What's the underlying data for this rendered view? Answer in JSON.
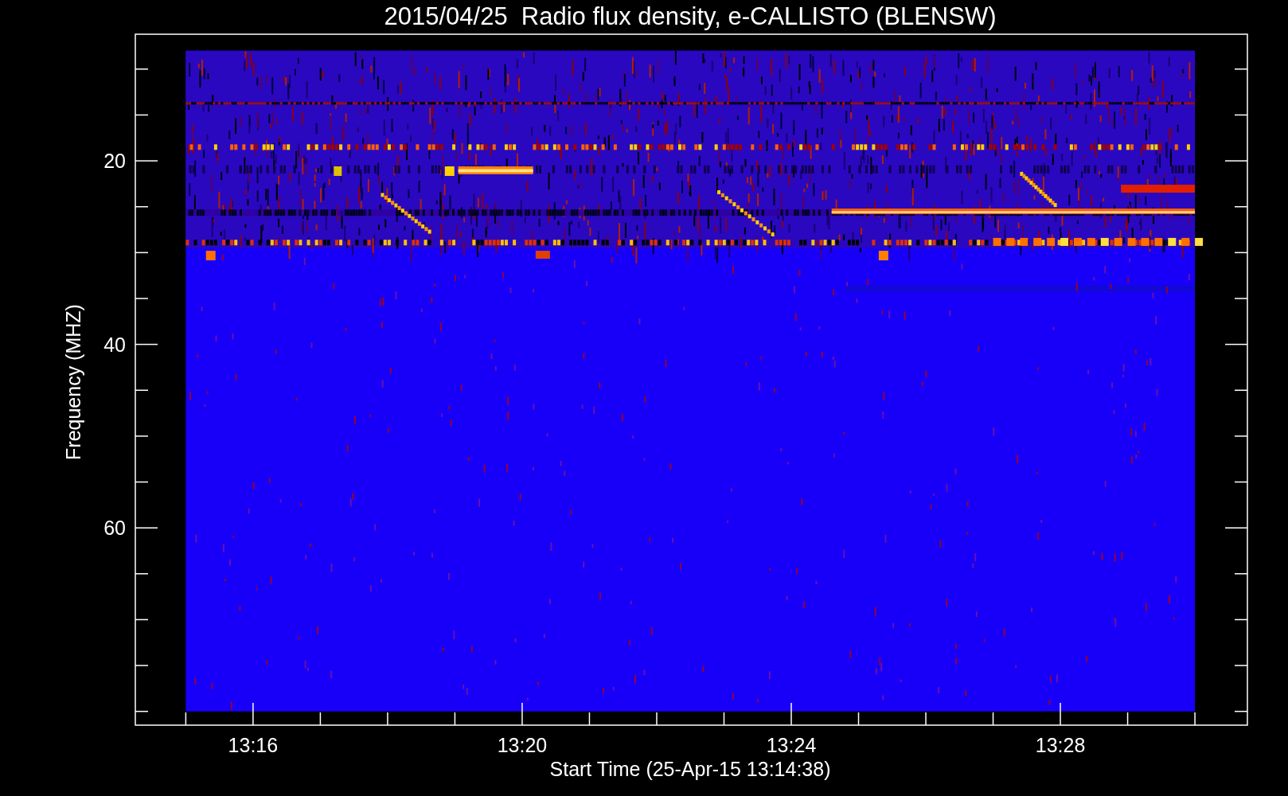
{
  "plot": {
    "title": "2015/04/25  Radio flux density, e-CALLISTO (BLENSW)",
    "xlabel": "Start Time (25-Apr-15 13:14:38)",
    "ylabel": "Frequency (MHZ)",
    "xticks": [
      "13:16",
      "13:20",
      "13:24",
      "13:28"
    ],
    "yticks": [
      "20",
      "40",
      "60"
    ]
  }
}
